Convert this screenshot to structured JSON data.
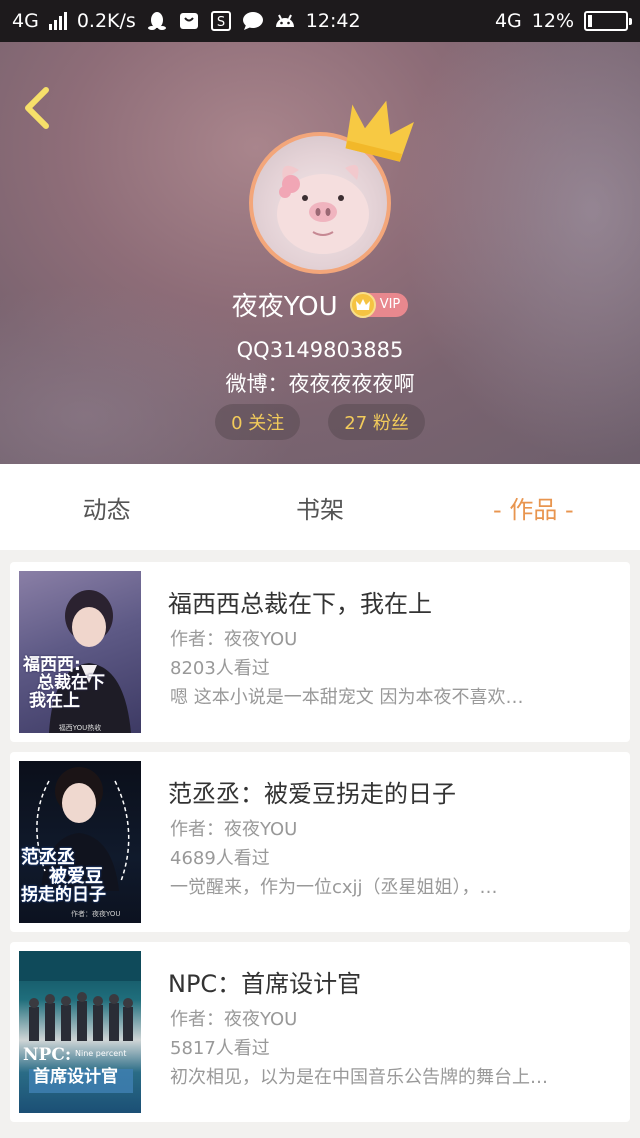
{
  "status_bar": {
    "network": "4G",
    "speed": "0.2K/s",
    "time": "12:42",
    "network_right": "4G",
    "battery": "12%",
    "battery_level": 0.12,
    "icons": [
      "signal-icon",
      "qq-icon",
      "bag-icon",
      "s-icon",
      "chat-icon",
      "android-icon",
      "battery-icon"
    ]
  },
  "profile": {
    "name": "夜夜YOU",
    "vip_label": "VIP",
    "qq": "QQ3149803885",
    "weibo": "微博：夜夜夜夜夜啊",
    "follow": "0 关注",
    "fans": "27 粉丝"
  },
  "tabs": [
    {
      "label": "动态"
    },
    {
      "label": "书架"
    },
    {
      "label": "- 作品 -"
    }
  ],
  "works": [
    {
      "title": "福西西总裁在下，我在上",
      "author": "作者：夜夜YOU",
      "views": "8203人看过",
      "desc": "嗯 这本小说是一本甜宠文 因为本夜不喜欢…",
      "cover_lines": [
        "福西西:",
        "总裁在下",
        "我在上"
      ],
      "cover_caption": "福西YOU热收"
    },
    {
      "title": "范丞丞：被爱豆拐走的日子",
      "author": "作者：夜夜YOU",
      "views": "4689人看过",
      "desc": "一觉醒来，作为一位cxjj（丞星姐姐），…",
      "cover_lines": [
        "范丞丞",
        "被爱豆",
        "拐走的日子"
      ],
      "cover_caption": "作者：夜夜YOU"
    },
    {
      "title": "NPC：首席设计官",
      "author": "作者：夜夜YOU",
      "views": "5817人看过",
      "desc": "初次相见，以为是在中国音乐公告牌的舞台上…",
      "cover_lines": [
        "NPC:",
        "首席设计官"
      ],
      "cover_caption": "Nine percent"
    }
  ],
  "colors": {
    "accent": "#e8954f",
    "pill_text": "#f2cb5b",
    "avatar_ring": "#f3a67a",
    "crown": "#f7c943"
  }
}
